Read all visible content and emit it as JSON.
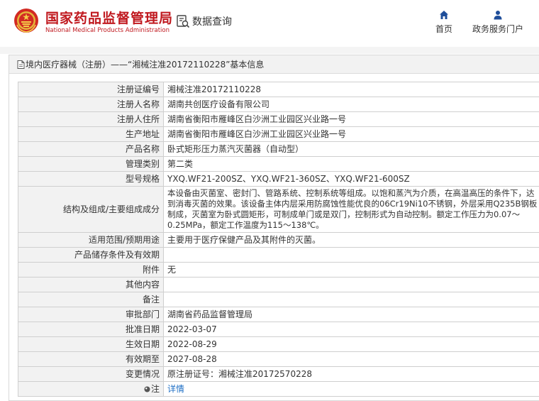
{
  "header": {
    "site_name_cn": "国家药品监督管理局",
    "site_name_en": "National Medical Products Administration",
    "search_label": "数据查询",
    "nav": [
      {
        "label": "首页",
        "icon": "home-icon"
      },
      {
        "label": "政务服务门户",
        "icon": "user-icon"
      }
    ]
  },
  "breadcrumb": "境内医疗器械（注册）——“湘械注准20172110228”基本信息",
  "rows": [
    {
      "label": "注册证编号",
      "value": "湘械注准20172110228"
    },
    {
      "label": "注册人名称",
      "value": "湖南共创医疗设备有限公司"
    },
    {
      "label": "注册人住所",
      "value": "湖南省衡阳市雁峰区白沙洲工业园区兴业路一号"
    },
    {
      "label": "生产地址",
      "value": "湖南省衡阳市雁峰区白沙洲工业园区兴业路一号"
    },
    {
      "label": "产品名称",
      "value": "卧式矩形压力蒸汽灭菌器（自动型）"
    },
    {
      "label": "管理类别",
      "value": "第二类"
    },
    {
      "label": "型号规格",
      "value": "YXQ.WF21-200SZ、YXQ.WF21-360SZ、YXQ.WF21-600SZ"
    },
    {
      "label": "结构及组成/主要组成成分",
      "value": "本设备由灭菌室、密封门、管路系统、控制系统等组成。以饱和蒸汽为介质，在高温高压的条件下，达到消毒灭菌的效果。该设备主体内层采用防腐蚀性能优良的06Cr19Ni10不锈钢，外层采用Q235B钢板制成，灭菌室为卧式圆矩形，可制成单门或是双门，控制形式为自动控制。额定工作压力为0.07～0.25MPa，额定工作温度为115～138℃。"
    },
    {
      "label": "适用范围/预期用途",
      "value": "主要用于医疗保健产品及其附件的灭菌。"
    },
    {
      "label": "产品储存条件及有效期",
      "value": ""
    },
    {
      "label": "附件",
      "value": "无"
    },
    {
      "label": "其他内容",
      "value": ""
    },
    {
      "label": "备注",
      "value": ""
    },
    {
      "label": "审批部门",
      "value": "湖南省药品监督管理局"
    },
    {
      "label": "批准日期",
      "value": "2022-03-07"
    },
    {
      "label": "生效日期",
      "value": "2022-08-29"
    },
    {
      "label": "有效期至",
      "value": "2027-08-28"
    },
    {
      "label": "变更情况",
      "value": "原注册证号：湘械注准20172570228"
    },
    {
      "label": "注",
      "value": "详情"
    }
  ],
  "colors": {
    "brand_red": "#c0191f",
    "link_blue": "#1f6fc5",
    "label_bg": "#f2f2f2"
  }
}
